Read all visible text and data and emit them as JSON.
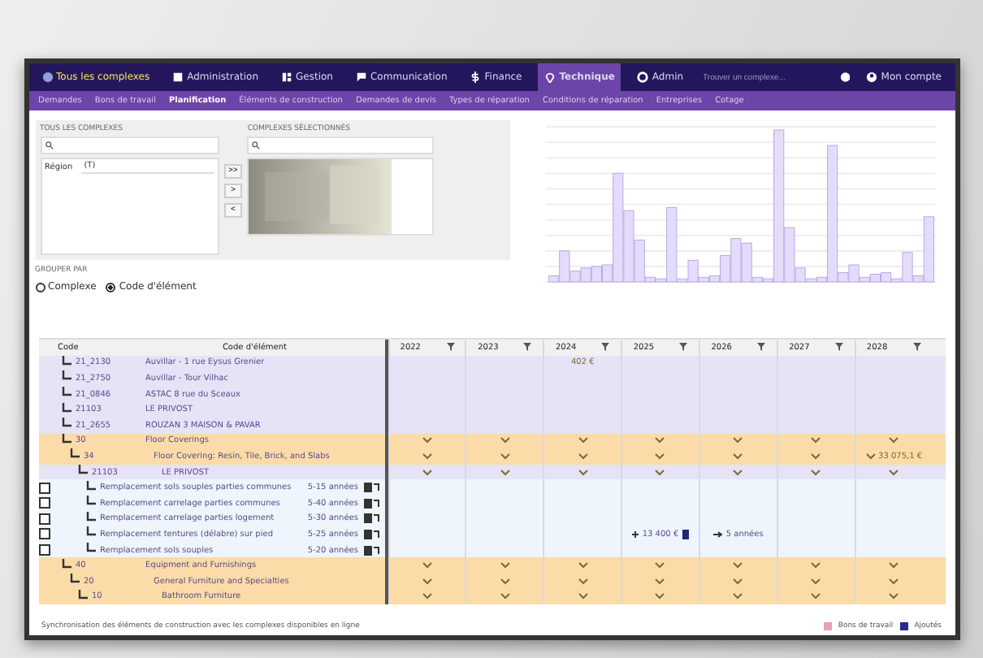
{
  "nav": {
    "items": [
      {
        "label": "Tous les complexes",
        "kind": "home",
        "selected": false
      },
      {
        "label": "Administration",
        "kind": "app",
        "selected": false
      },
      {
        "label": "Gestion",
        "kind": "grid",
        "selected": false
      },
      {
        "label": "Communication",
        "kind": "flag",
        "selected": false
      },
      {
        "label": "Finance",
        "kind": "dollar",
        "selected": false
      },
      {
        "label": "Technique",
        "kind": "pin",
        "selected": true
      },
      {
        "label": "Admin",
        "kind": "gear",
        "selected": false
      }
    ],
    "search": {
      "placeholder": "Trouver un complexe..."
    },
    "account": "Mon compte"
  },
  "subnav": [
    {
      "label": "Demandes",
      "selected": false
    },
    {
      "label": "Bons de travail",
      "selected": false
    },
    {
      "label": "Planification",
      "selected": true
    },
    {
      "label": "Éléments de construction",
      "selected": false
    },
    {
      "label": "Demandes de devis",
      "selected": false
    },
    {
      "label": "Types de réparation",
      "selected": false
    },
    {
      "label": "Conditions de réparation",
      "selected": false
    },
    {
      "label": "Entreprises",
      "selected": false
    },
    {
      "label": "Cotage",
      "selected": false
    }
  ],
  "filters": {
    "all_title": "TOUS LES COMPLEXES",
    "selected_title": "COMPLEXES SÉLECTIONNÉS",
    "region_label": "Région",
    "region_value": "(T)",
    "move_buttons": [
      ">>",
      ">",
      "<"
    ],
    "group_title": "GROUPER PAR",
    "group_options": [
      {
        "label": "Complexe",
        "selected": false
      },
      {
        "label": "Code d'élément",
        "selected": true
      }
    ]
  },
  "table": {
    "columns": [
      "Code",
      "Code d'élément"
    ],
    "years": [
      "2022",
      "2023",
      "2024",
      "2025",
      "2026",
      "2027",
      "2028"
    ],
    "rows": [
      {
        "kind": "complex",
        "code": "21_2130",
        "name": "Auvillar - 1 rue Eysus Grenier",
        "cells": [
          null,
          null,
          {
            "kind": "amount",
            "text": "402 €"
          },
          null,
          null,
          null,
          null
        ]
      },
      {
        "kind": "complex",
        "code": "21_2750",
        "name": "Auvillar - Tour Vilhac"
      },
      {
        "kind": "complex",
        "code": "21_0846",
        "name": "ASTAC 8 rue du Sceaux"
      },
      {
        "kind": "complex",
        "code": "21103",
        "name": "LE PRIVOST"
      },
      {
        "kind": "complex",
        "code": "21_2655",
        "name": "ROUZAN 3 MAISON & PAVAR"
      },
      {
        "kind": "group",
        "code": "30",
        "name": "Floor Coverings",
        "children": [
          {
            "kind": "group",
            "code": "34",
            "name": "Floor Covering: Resin, Tile, Brick, and Slabs",
            "cells": [
              null,
              null,
              null,
              null,
              null,
              null,
              {
                "kind": "amount",
                "text": "33 075,1 €"
              }
            ],
            "children": [
              {
                "kind": "complex",
                "code": "21103",
                "name": "LE PRIVOST",
                "children": [
                  {
                    "kind": "element",
                    "name": "Remplacement sols souples parties communes",
                    "term": "5-15 années",
                    "checked": false
                  },
                  {
                    "kind": "element",
                    "name": "Remplacement carrelage parties communes",
                    "term": "5-40 années",
                    "checked": false
                  },
                  {
                    "kind": "element",
                    "name": "Remplacement carrelage parties logement",
                    "term": "5-30 années",
                    "checked": false
                  },
                  {
                    "kind": "element",
                    "name": "Remplacement tentures (délabre) sur pied",
                    "term": "5-25 années",
                    "checked": false,
                    "cells": [
                      null,
                      null,
                      null,
                      {
                        "kind": "planned",
                        "text": "13 400 €"
                      },
                      {
                        "kind": "interval",
                        "text": "5 années"
                      },
                      null,
                      null
                    ]
                  },
                  {
                    "kind": "element",
                    "name": "Remplacement sols souples",
                    "term": "5-20 années",
                    "checked": false
                  }
                ]
              }
            ]
          }
        ]
      },
      {
        "kind": "group",
        "code": "40",
        "name": "Equipment and Furnishings",
        "children": [
          {
            "kind": "group",
            "code": "20",
            "name": "General Furniture and Specialties",
            "children": [
              {
                "kind": "group",
                "code": "10",
                "name": "Bathroom Furniture"
              }
            ]
          }
        ]
      }
    ]
  },
  "footer": {
    "note": "Synchronisation des éléments de construction avec les complexes disponibles en ligne",
    "legend": [
      {
        "label": "Bons de travail",
        "color": "#e8a0b8"
      },
      {
        "label": "Ajoutés",
        "color": "#2a2a8a"
      }
    ]
  }
}
